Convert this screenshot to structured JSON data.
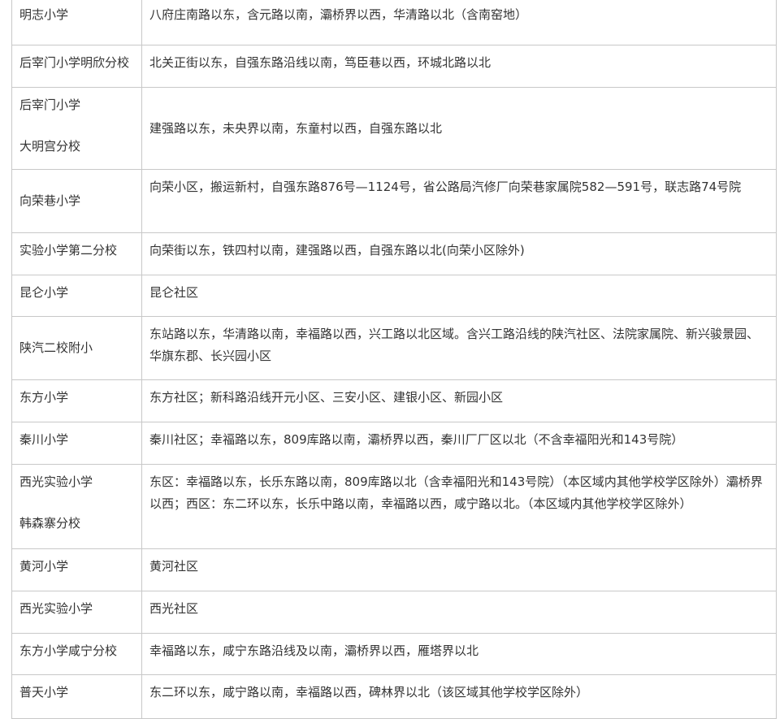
{
  "rows": [
    {
      "school": "明志小学",
      "area": "八府庄南路以东，含元路以南，灞桥界以西，华清路以北（含南窑地）"
    },
    {
      "school": "后宰门小学明欣分校",
      "area": "北关正街以东，自强东路沿线以南，笃臣巷以西，环城北路以北"
    },
    {
      "school_lines": [
        "后宰门小学",
        "大明宫分校"
      ],
      "area": "建强路以东，未央界以南，东童村以西，自强东路以北"
    },
    {
      "school": "向荣巷小学",
      "area": "向荣小区，搬运新村，自强东路876号—1124号，省公路局汽修厂向荣巷家属院582—591号，联志路74号院"
    },
    {
      "school": "实验小学第二分校",
      "area": "向荣街以东，铁四村以南，建强路以西，自强东路以北(向荣小区除外)"
    },
    {
      "school": "昆仑小学",
      "area": "昆仑社区"
    },
    {
      "school": "陕汽二校附小",
      "area": "东站路以东，华清路以南，幸福路以西，兴工路以北区域。含兴工路沿线的陕汽社区、法院家属院、新兴骏景园、华旗东郡、长兴园小区"
    },
    {
      "school": "东方小学",
      "area": "东方社区；新科路沿线开元小区、三安小区、建银小区、新园小区"
    },
    {
      "school": "秦川小学",
      "area": "秦川社区；幸福路以东，809库路以南，灞桥界以西，秦川厂厂区以北（不含幸福阳光和143号院）"
    },
    {
      "school_lines": [
        "西光实验小学",
        "韩森寨分校"
      ],
      "area": "东区：幸福路以东，长乐东路以南，809库路以北（含幸福阳光和143号院）（本区域内其他学校学区除外）灞桥界以西；西区：东二环以东，长乐中路以南，幸福路以西，咸宁路以北。（本区域内其他学校学区除外）"
    },
    {
      "school": "黄河小学",
      "area": "黄河社区"
    },
    {
      "school": "西光实验小学",
      "area": "西光社区"
    },
    {
      "school": "东方小学咸宁分校",
      "area": "幸福路以东，咸宁东路沿线及以南，灞桥界以西，雁塔界以北"
    },
    {
      "school": "普天小学",
      "area": "东二环以东，咸宁路以南，幸福路以西，碑林界以北（该区域其他学校学区除外）"
    }
  ]
}
